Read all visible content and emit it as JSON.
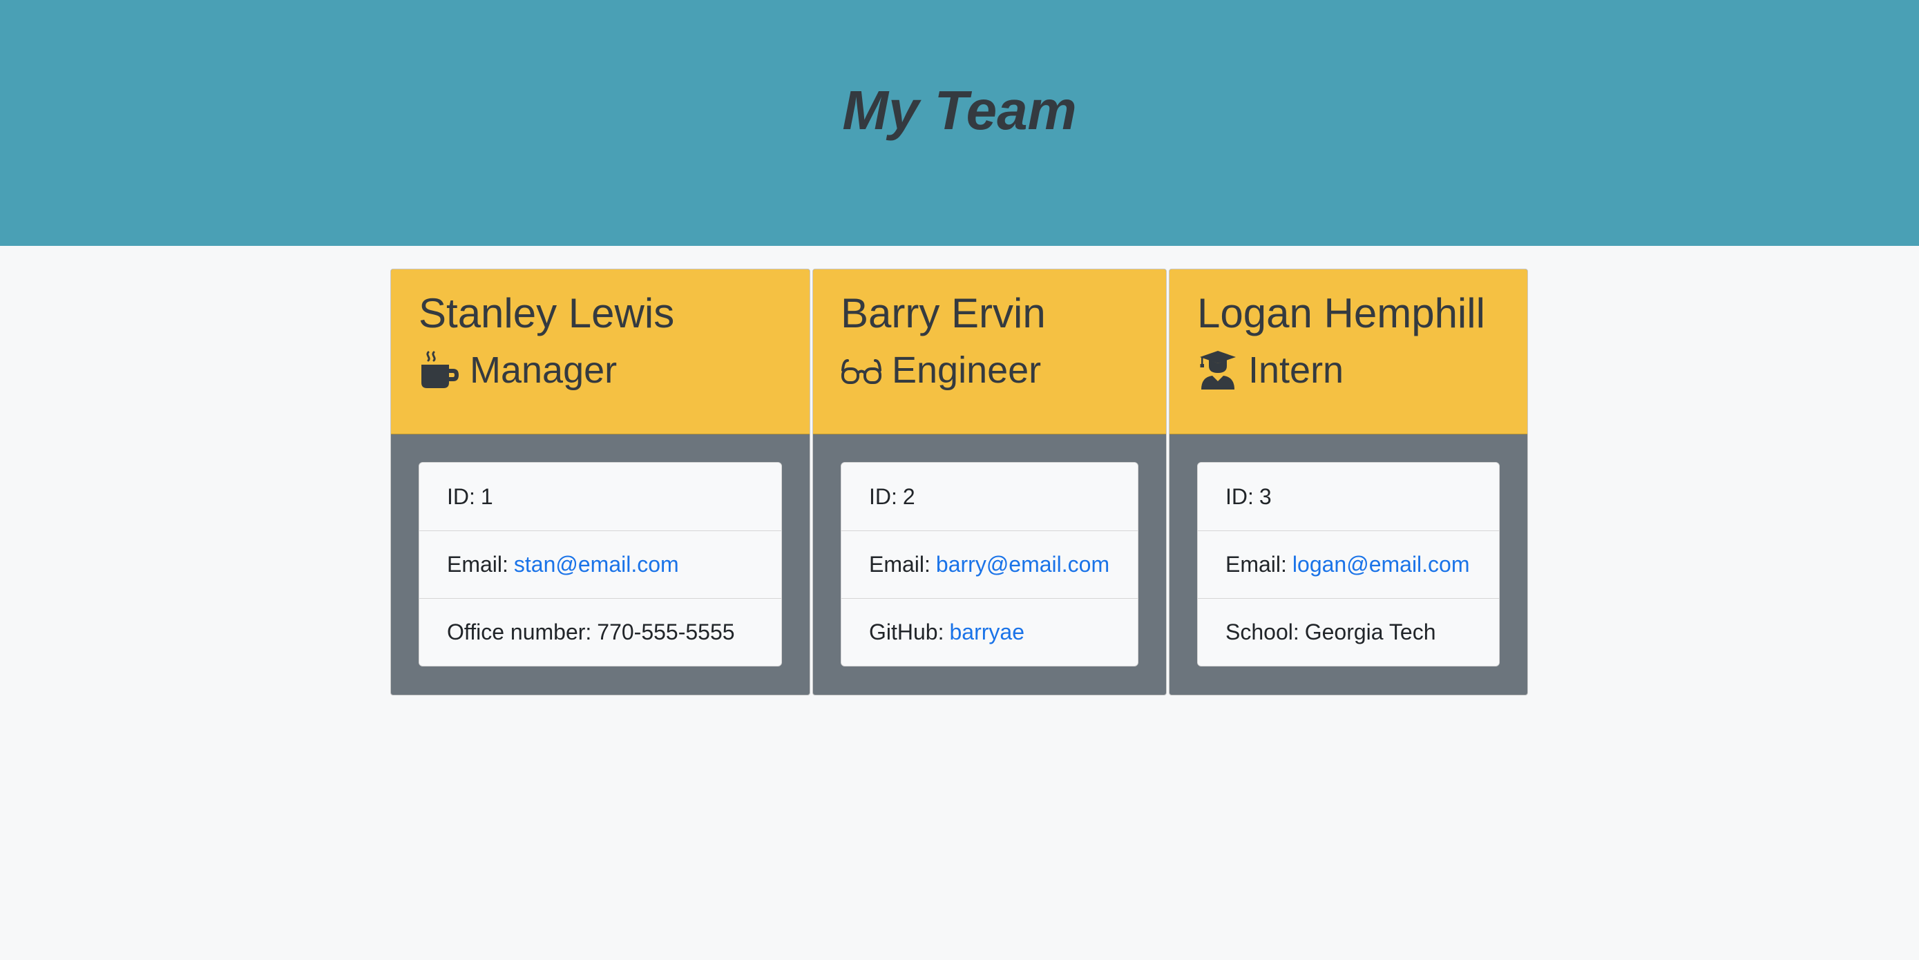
{
  "header": {
    "title": "My Team"
  },
  "colors": {
    "header_bg": "#4aa0b5",
    "card_header_bg": "#f5c143",
    "card_body_bg": "#6c757d",
    "link": "#1a73e8"
  },
  "employees": [
    {
      "name": "Stanley Lewis",
      "role": "Manager",
      "role_icon": "mug-icon",
      "id_label": "ID:",
      "id": "1",
      "email_label": "Email:",
      "email": "stan@email.com",
      "extra_label": "Office number:",
      "extra_value": "770-555-5555"
    },
    {
      "name": "Barry Ervin",
      "role": "Engineer",
      "role_icon": "glasses-icon",
      "id_label": "ID:",
      "id": "2",
      "email_label": "Email:",
      "email": "barry@email.com",
      "extra_label": "GitHub:",
      "extra_value": "barryae"
    },
    {
      "name": "Logan Hemphill",
      "role": "Intern",
      "role_icon": "graduate-icon",
      "id_label": "ID:",
      "id": "3",
      "email_label": "Email:",
      "email": "logan@email.com",
      "extra_label": "School:",
      "extra_value": "Georgia Tech"
    }
  ]
}
